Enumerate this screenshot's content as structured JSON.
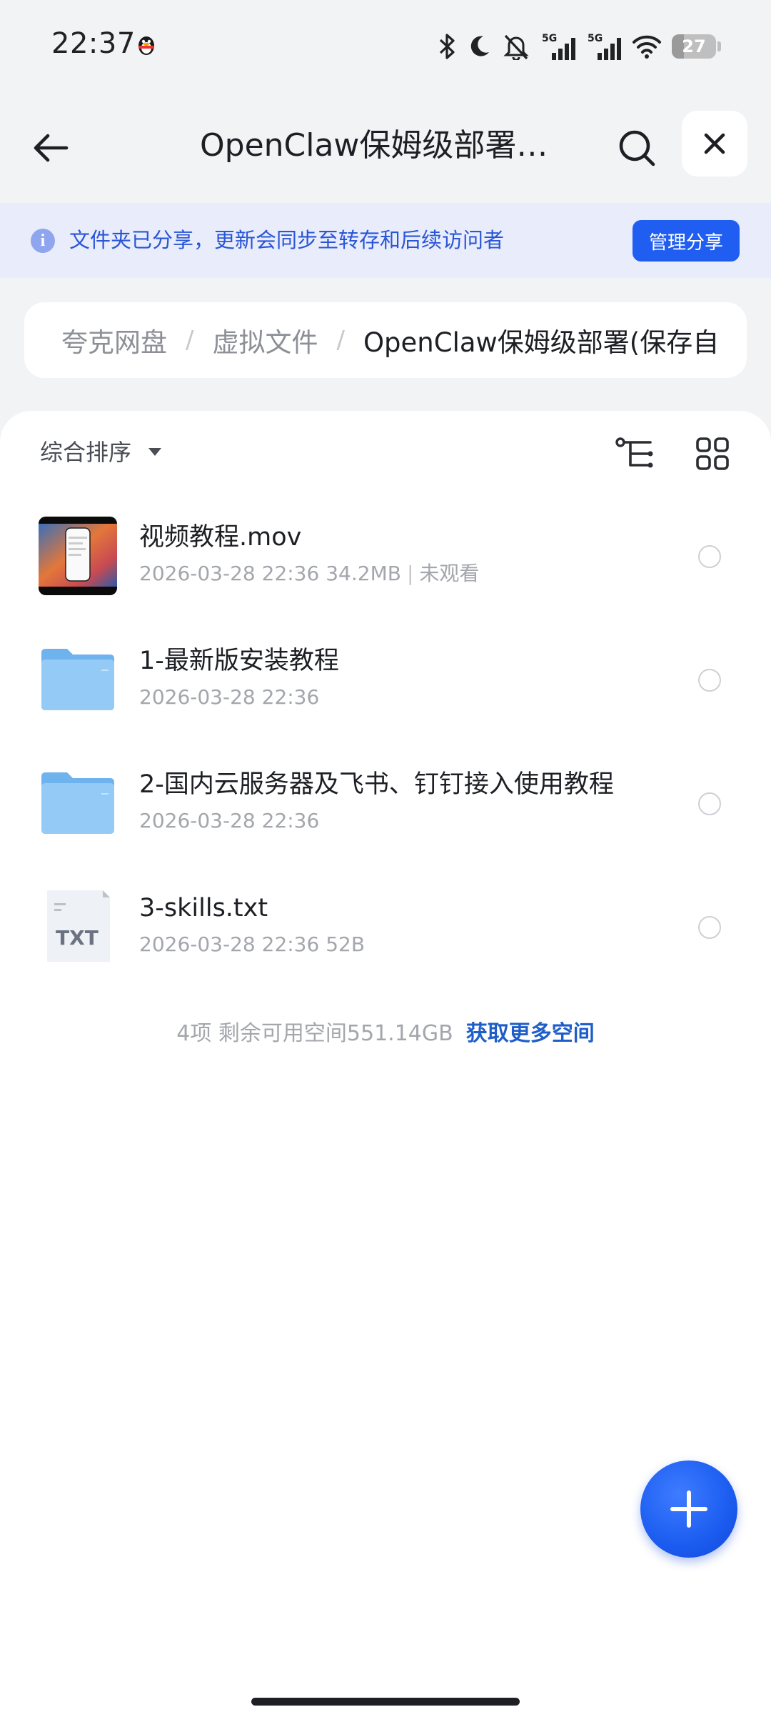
{
  "status_bar": {
    "time": "22:37",
    "battery": "27",
    "battery_level": 0.27,
    "signal1_label": "5G",
    "signal2_label": "5G",
    "icons": [
      "qq-penguin-icon",
      "bluetooth-icon",
      "moon-icon",
      "bell-muted-icon",
      "signal-icon",
      "signal-icon",
      "wifi-icon",
      "battery-icon"
    ]
  },
  "header": {
    "title": "OpenClaw保姆级部署(...",
    "back_icon": "arrow-left-icon",
    "search_icon": "search-icon",
    "close_icon": "close-icon"
  },
  "banner": {
    "text": "文件夹已分享，更新会同步至转存和后续访问者",
    "button": "管理分享",
    "info_symbol": "i"
  },
  "breadcrumb": {
    "items": [
      "夸克网盘",
      "虚拟文件"
    ],
    "separator": "/",
    "current": "OpenClaw保姆级部署(保存自"
  },
  "toolbar": {
    "sort_label": "综合排序",
    "tree_icon": "tree-view-icon",
    "grid_icon": "grid-view-icon"
  },
  "files": [
    {
      "name": "视频教程.mov",
      "date": "2026-03-28 22:36",
      "size": "34.2MB",
      "status": "未观看",
      "icon": "video-thumbnail"
    },
    {
      "name": "1-最新版安装教程",
      "date": "2026-03-28 22:36",
      "icon": "folder-icon"
    },
    {
      "name": "2-国内云服务器及飞书、钉钉接入使用教程",
      "date": "2026-03-28 22:36",
      "icon": "folder-icon"
    },
    {
      "name": "3-skills.txt",
      "date": "2026-03-28 22:36",
      "size": "52B",
      "icon": "txt-file-icon",
      "ext_label": "TXT"
    }
  ],
  "footer": {
    "count_text": "4项 剩余可用空间551.14GB",
    "link": "获取更多空间"
  },
  "fab": {
    "icon": "plus-icon"
  },
  "colors": {
    "accent": "#1f5ef0",
    "banner_bg": "#e8ecfb",
    "folder": "#8cc4f4"
  }
}
